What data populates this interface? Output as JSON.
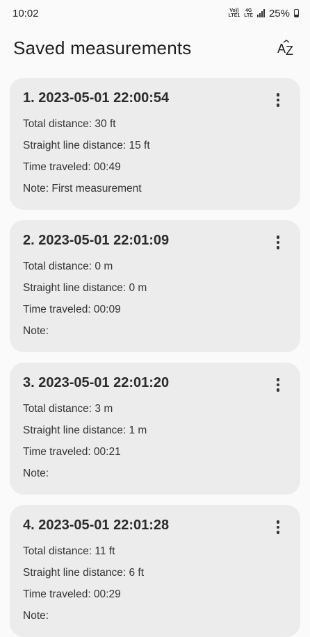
{
  "status": {
    "time": "10:02",
    "net1": "Vo)) LTE1",
    "net2": "4G LTE",
    "battery": "25%"
  },
  "header": {
    "title": "Saved measurements",
    "sort_icon_label": "A͡Z"
  },
  "measurements": [
    {
      "title": "1. 2023-05-01 22:00:54",
      "total": "Total distance: 30 ft",
      "straight": "Straight line distance: 15 ft",
      "time": "Time traveled: 00:49",
      "note": "Note: First measurement"
    },
    {
      "title": "2. 2023-05-01 22:01:09",
      "total": "Total distance: 0 m",
      "straight": "Straight line distance: 0 m",
      "time": "Time traveled: 00:09",
      "note": "Note:"
    },
    {
      "title": "3. 2023-05-01 22:01:20",
      "total": "Total distance: 3 m",
      "straight": "Straight line distance: 1 m",
      "time": "Time traveled: 00:21",
      "note": "Note:"
    },
    {
      "title": "4. 2023-05-01 22:01:28",
      "total": "Total distance: 11 ft",
      "straight": "Straight line distance: 6 ft",
      "time": "Time traveled: 00:29",
      "note": "Note:"
    }
  ]
}
